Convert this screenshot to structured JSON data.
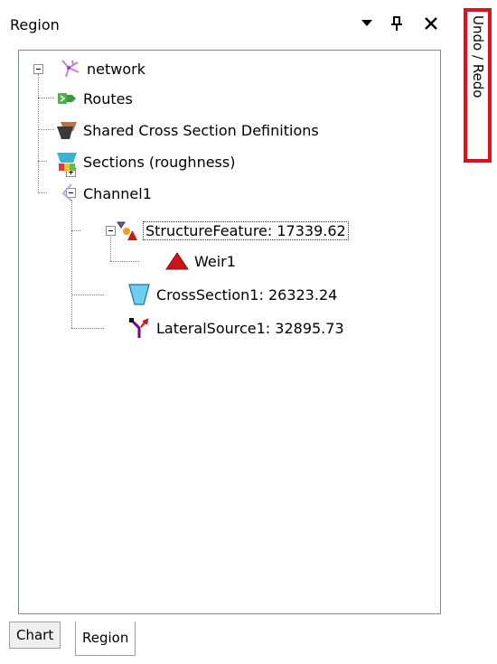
{
  "panel": {
    "title": "Region",
    "buttons": [
      "dropdown-arrow-icon",
      "pin-icon",
      "close-icon"
    ]
  },
  "tree": {
    "root": {
      "label": "network",
      "icon": "network-icon"
    },
    "items": [
      {
        "label": "Routes",
        "icon": "routes-icon"
      },
      {
        "label": "Shared Cross Section Definitions",
        "icon": "cross-section-definitions-icon"
      },
      {
        "label": "Sections (roughness)",
        "icon": "roughness-sections-icon"
      },
      {
        "label": "Channel1",
        "icon": "channel-icon"
      },
      {
        "label": "StructureFeature: 17339.62",
        "icon": "structure-feature-icon",
        "selected": true
      },
      {
        "label": "Weir1",
        "icon": "weir-icon"
      },
      {
        "label": "CrossSection1: 26323.24",
        "icon": "cross-section-icon"
      },
      {
        "label": "LateralSource1: 32895.73",
        "icon": "lateral-source-icon"
      }
    ]
  },
  "tabs": [
    {
      "label": "Chart",
      "active": false
    },
    {
      "label": "Region",
      "active": true
    }
  ],
  "side_tab": {
    "label": "Undo / Redo"
  },
  "colors": {
    "highlight_border": "#e0101a",
    "tree_border": "#828790"
  }
}
